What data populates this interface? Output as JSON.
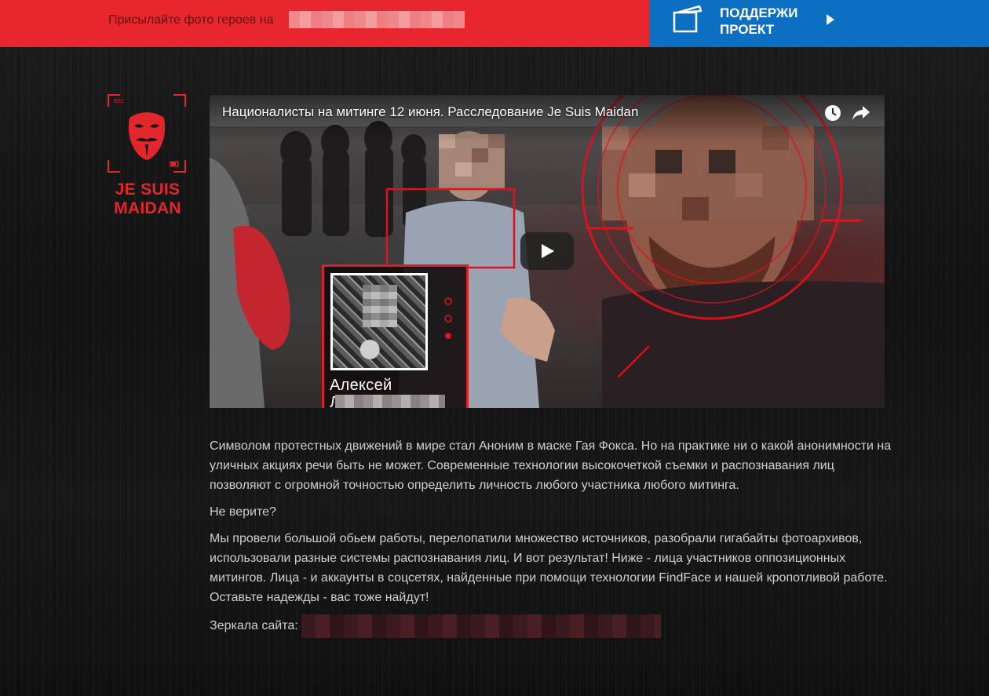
{
  "topbar": {
    "send_photos_text": "Присылайте фото героев на",
    "support_label_line1": "ПОДДЕРЖИ",
    "support_label_line2": "ПРОЕКТ",
    "accent_red": "#e8262d",
    "accent_blue": "#0c6fc1"
  },
  "logo": {
    "line1": "JE SUIS",
    "line2": "MAIDAN",
    "rec_label": "REC",
    "color": "#e3262b"
  },
  "video": {
    "title": "Националисты на митинге 12 июня. Расследование Je Suis Maidan",
    "watch_later_icon": "clock-icon",
    "share_icon": "share-arrow-icon",
    "play_icon": "play-icon",
    "card_name": "Алексей",
    "card_surname_initial": "Л"
  },
  "article": {
    "paragraph1": "Символом протестных движений в мире стал Аноним в маске Гая Фокса. Но на практике ни о какой анонимности на уличных акциях речи быть не может. Современные технологии высокочеткой съемки и распознавания лиц позволяют с огромной точностью определить личность любого участника любого митинга.",
    "paragraph2": "Не верите?",
    "paragraph3": "Мы провели большой обьем работы, перелопатили множество источников, разобрали гигабайты фотоархивов, использовали разные системы распознавания лиц. И вот результат! Ниже - лица участников оппозиционных митингов. Лица - и аккаунты в соцсетях, найденные при помощи технологии FindFace и нашей кропотливой работе.",
    "paragraph3b": "Оставьте надежды - вас тоже найдут!",
    "mirrors_label": "Зеркала сайта:"
  }
}
